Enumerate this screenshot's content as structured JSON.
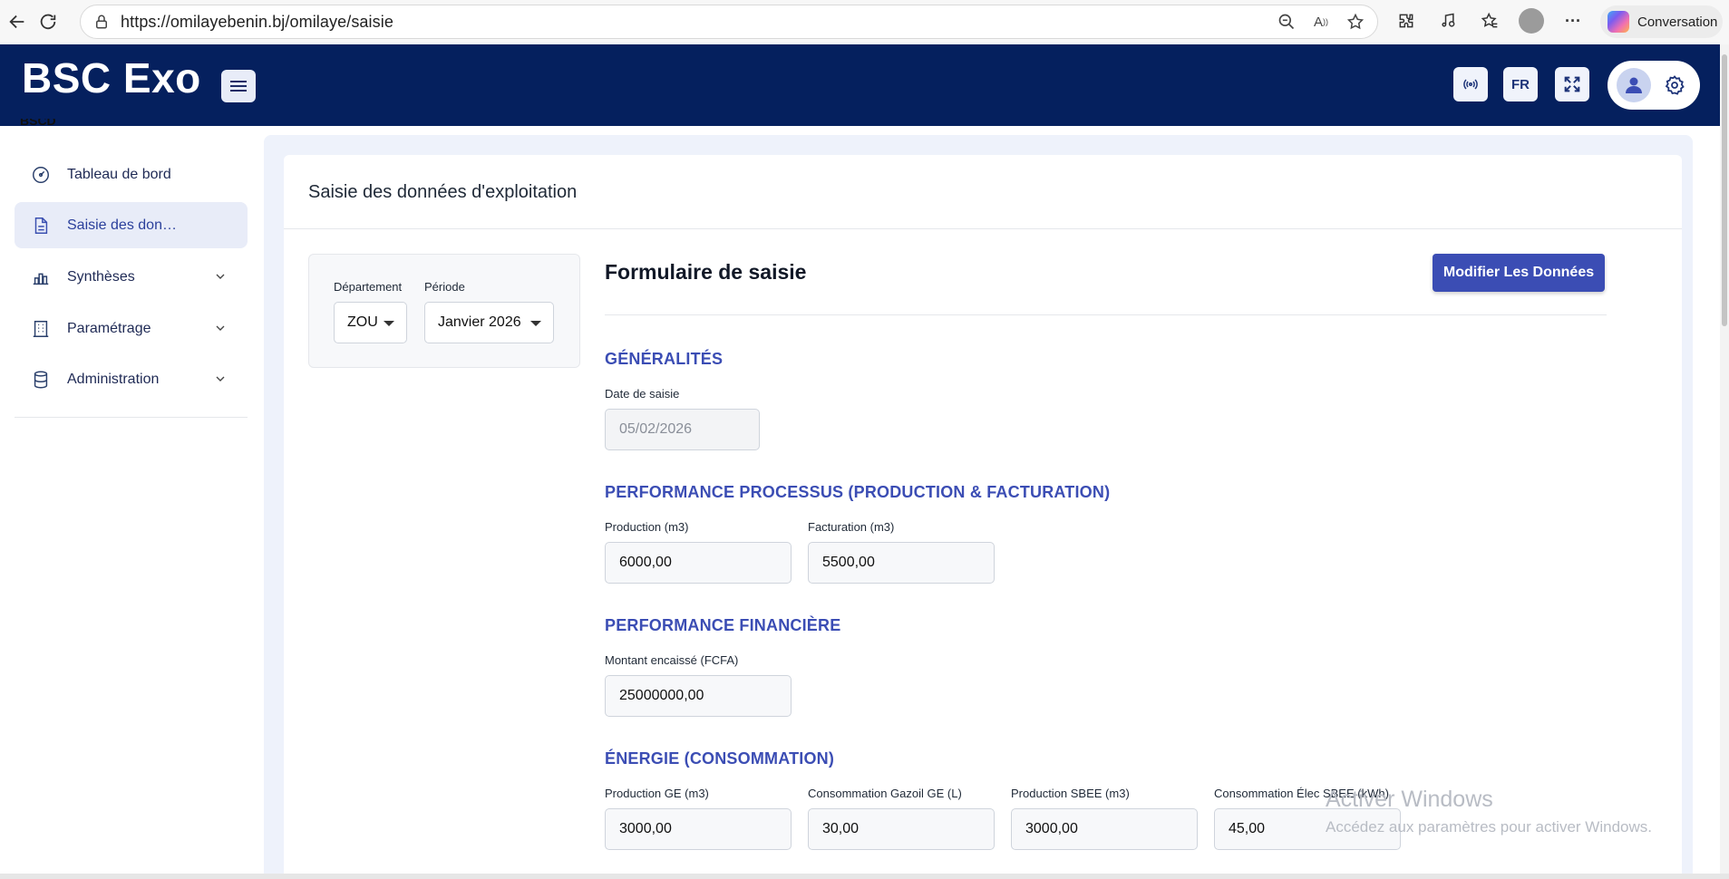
{
  "browser": {
    "url": "https://omilayebenin.bj/omilaye/saisie",
    "copilot_label": "Conversation",
    "icons": [
      "back-icon",
      "refresh-icon",
      "lock-icon",
      "zoom-icon",
      "read-aloud-icon",
      "favorite-star-icon",
      "extensions-icon",
      "media-icon",
      "favorites-icon",
      "profile-icon",
      "more-icon"
    ]
  },
  "header": {
    "brand": "BSC Exo",
    "lang": "FR",
    "colors": {
      "bar": "#05205e",
      "accent": "#3b4db4"
    }
  },
  "sidebar": {
    "partial_label": "BSCD",
    "items": [
      {
        "label": "Tableau de bord",
        "icon": "dashboard-icon"
      },
      {
        "label": "Saisie des don…",
        "icon": "document-icon"
      },
      {
        "label": "Synthèses",
        "icon": "bar-chart-icon"
      },
      {
        "label": "Paramétrage",
        "icon": "building-icon"
      },
      {
        "label": "Administration",
        "icon": "database-icon"
      }
    ]
  },
  "page": {
    "title": "Saisie des données d'exploitation"
  },
  "filters": {
    "departement_label": "Département",
    "departement_value": "ZOU",
    "periode_label": "Période",
    "periode_value": "Janvier 2026"
  },
  "form": {
    "title": "Formulaire de saisie",
    "modify_button": "Modifier Les Données",
    "generalites": {
      "title": "GÉNÉRALITÉS",
      "date_label": "Date de saisie",
      "date_value": "05/02/2026"
    },
    "processus": {
      "title": "PERFORMANCE PROCESSUS (PRODUCTION & FACTURATION)",
      "production_label": "Production (m3)",
      "production_value": "6000,00",
      "facturation_label": "Facturation (m3)",
      "facturation_value": "5500,00"
    },
    "financiere": {
      "title": "PERFORMANCE FINANCIÈRE",
      "montant_label": "Montant encaissé (FCFA)",
      "montant_value": "25000000,00"
    },
    "energie": {
      "title": "ÉNERGIE (CONSOMMATION)",
      "fields": [
        {
          "label": "Production GE (m3)",
          "value": "3000,00"
        },
        {
          "label": "Consommation Gazoil GE (L)",
          "value": "30,00"
        },
        {
          "label": "Production SBEE (m3)",
          "value": "3000,00"
        },
        {
          "label": "Consommation Élec SBEE (kWh)",
          "value": "45,00"
        }
      ]
    }
  },
  "watermark": {
    "line1": "Activer Windows",
    "line2": "Accédez aux paramètres pour activer Windows."
  }
}
